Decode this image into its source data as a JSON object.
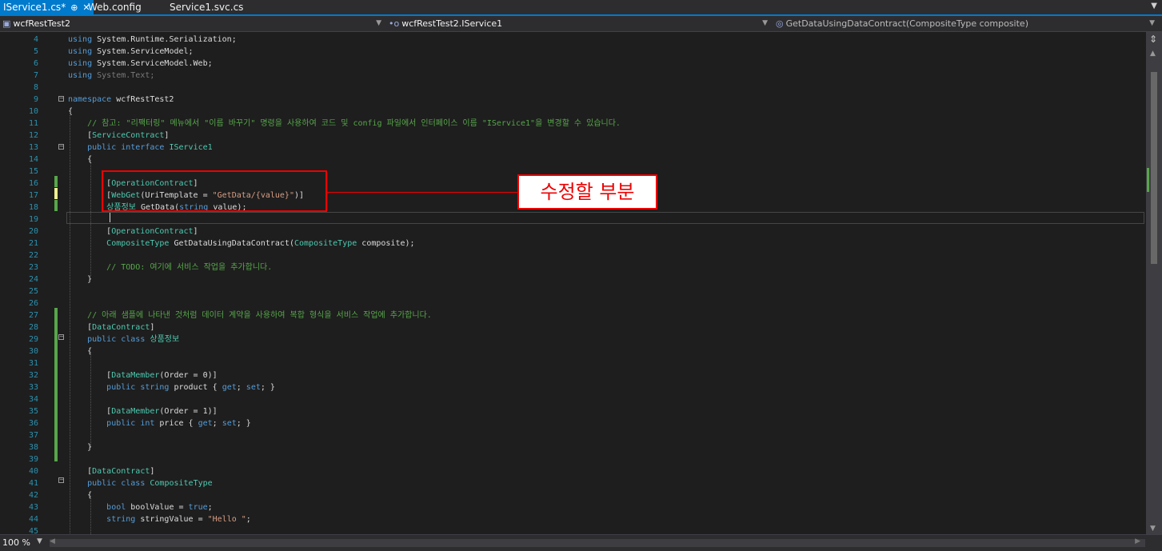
{
  "tabs": [
    {
      "label": "IService1.cs*",
      "pin": "⊕",
      "close": "✕",
      "active": true
    },
    {
      "label": "Web.config",
      "active": false
    },
    {
      "label": "Service1.svc.cs",
      "active": false
    }
  ],
  "navbar": {
    "project": "wcfRestTest2",
    "type": "wcfRestTest2.IService1",
    "member": "GetDataUsingDataContract(CompositeType composite)"
  },
  "annotation": {
    "label": "수정할 부분"
  },
  "status": {
    "zoom": "100 %"
  },
  "colors": {
    "accent": "#007acc",
    "callout_border": "#ee0000",
    "keyword": "#569cd6",
    "type": "#4ec9b0",
    "comment": "#57a64a",
    "string": "#d69d85"
  },
  "code_lines": [
    {
      "n": "4",
      "text": "using System.Runtime.Serialization;"
    },
    {
      "n": "5",
      "text": "using System.ServiceModel;"
    },
    {
      "n": "6",
      "text": "using System.ServiceModel.Web;"
    },
    {
      "n": "7",
      "text": "using System.Text;"
    },
    {
      "n": "8",
      "text": ""
    },
    {
      "n": "9",
      "text": "namespace wcfRestTest2"
    },
    {
      "n": "10",
      "text": "{"
    },
    {
      "n": "11",
      "text": "    // 참고: \"리팩터링\" 메뉴에서 \"이름 바꾸기\" 명령을 사용하여 코드 및 config 파일에서 인터페이스 이름 \"IService1\"을 변경할 수 있습니다."
    },
    {
      "n": "12",
      "text": "    [ServiceContract]"
    },
    {
      "n": "13",
      "text": "    public interface IService1"
    },
    {
      "n": "14",
      "text": "    {"
    },
    {
      "n": "15",
      "text": ""
    },
    {
      "n": "16",
      "text": "        [OperationContract]"
    },
    {
      "n": "17",
      "text": "        [WebGet(UriTemplate = \"GetData/{value}\")]"
    },
    {
      "n": "18",
      "text": "        상품정보 GetData(string value);"
    },
    {
      "n": "19",
      "text": ""
    },
    {
      "n": "20",
      "text": "        [OperationContract]"
    },
    {
      "n": "21",
      "text": "        CompositeType GetDataUsingDataContract(CompositeType composite);"
    },
    {
      "n": "22",
      "text": ""
    },
    {
      "n": "23",
      "text": "        // TODO: 여기에 서비스 작업을 추가합니다."
    },
    {
      "n": "24",
      "text": "    }"
    },
    {
      "n": "25",
      "text": ""
    },
    {
      "n": "26",
      "text": ""
    },
    {
      "n": "27",
      "text": "    // 아래 샘플에 나타낸 것처럼 데이터 계약을 사용하여 복합 형식을 서비스 작업에 추가합니다."
    },
    {
      "n": "28",
      "text": "    [DataContract]"
    },
    {
      "n": "29",
      "text": "    public class 상품정보"
    },
    {
      "n": "30",
      "text": "    {"
    },
    {
      "n": "31",
      "text": ""
    },
    {
      "n": "32",
      "text": "        [DataMember(Order = 0)]"
    },
    {
      "n": "33",
      "text": "        public string product { get; set; }"
    },
    {
      "n": "34",
      "text": ""
    },
    {
      "n": "35",
      "text": "        [DataMember(Order = 1)]"
    },
    {
      "n": "36",
      "text": "        public int price { get; set; }"
    },
    {
      "n": "37",
      "text": ""
    },
    {
      "n": "38",
      "text": "    }"
    },
    {
      "n": "39",
      "text": ""
    },
    {
      "n": "40",
      "text": "    [DataContract]"
    },
    {
      "n": "41",
      "text": "    public class CompositeType"
    },
    {
      "n": "42",
      "text": "    {"
    },
    {
      "n": "43",
      "text": "        bool boolValue = true;"
    },
    {
      "n": "44",
      "text": "        string stringValue = \"Hello \";"
    },
    {
      "n": "45",
      "text": ""
    }
  ]
}
